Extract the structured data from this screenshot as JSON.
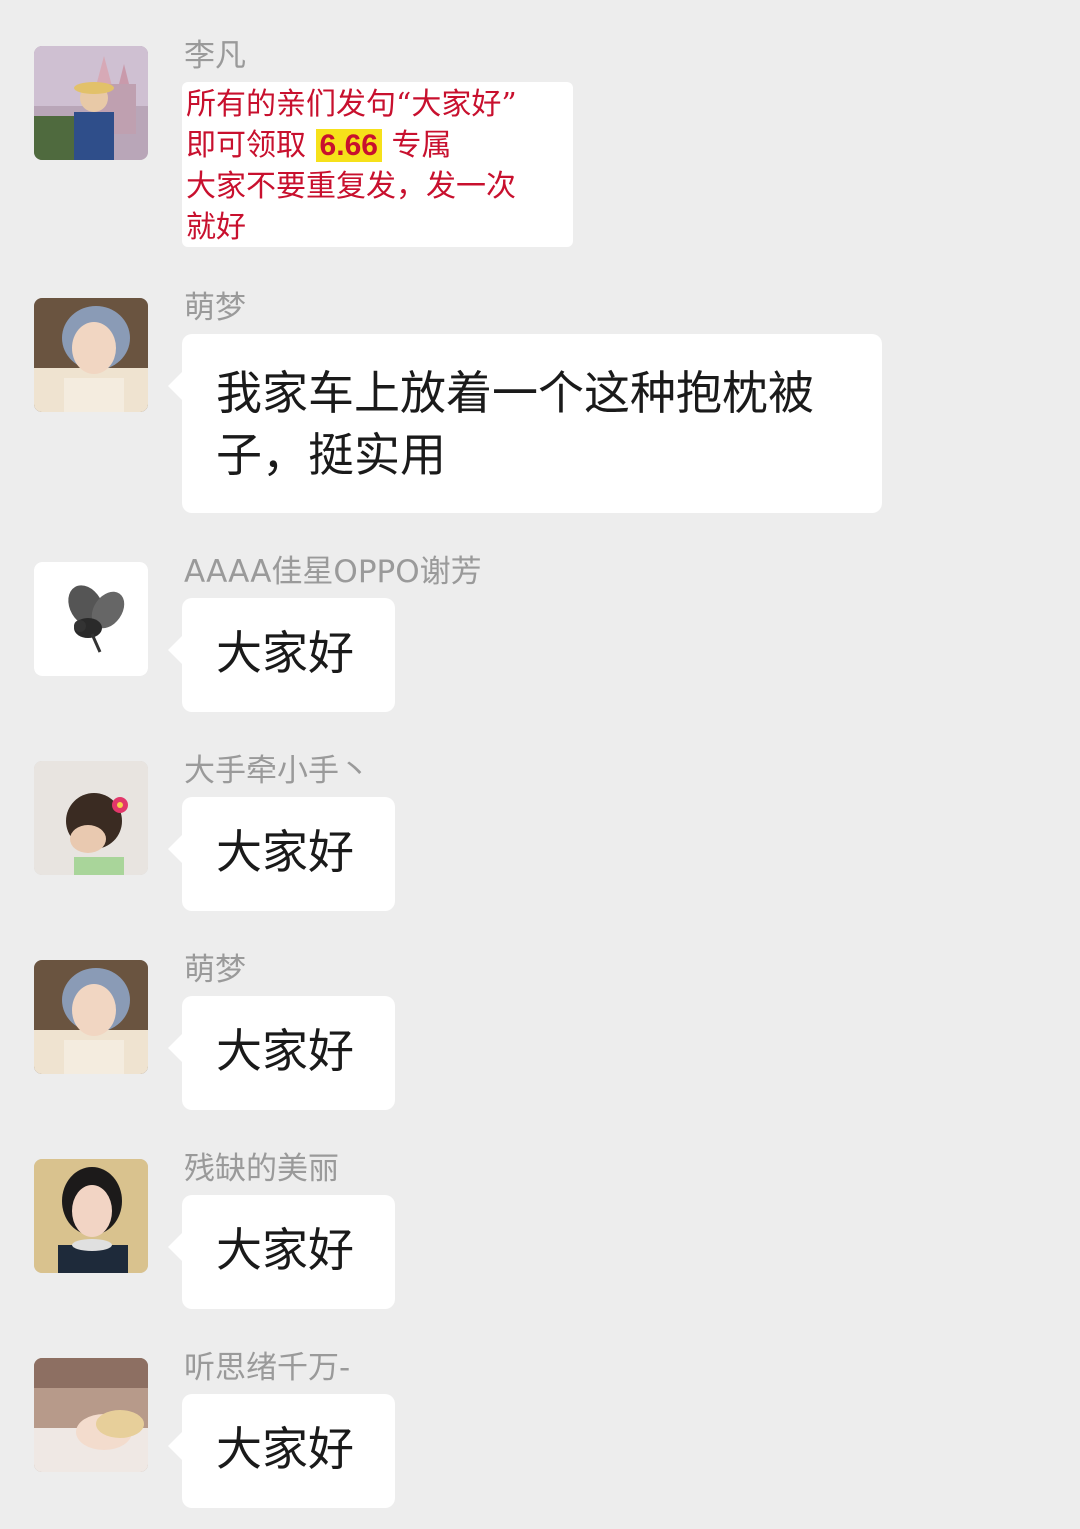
{
  "messages": [
    {
      "sender": "李凡",
      "avatar_icon": "portrait-castle-avatar-icon",
      "poster": {
        "line1": "所有的亲们发句“大家好”",
        "line2_prefix": "即可领取",
        "amount": "6.66",
        "line2_suffix": "专属",
        "line3": "大家不要重复发，发一次",
        "line4": "就好"
      }
    },
    {
      "sender": "萌梦",
      "avatar_icon": "portrait-woman-avatar-icon",
      "text_line1": "我家车上放着一个这种抱枕被",
      "text_line2": "子，挺实用"
    },
    {
      "sender": "AAAA佳星OPPO谢芳",
      "avatar_icon": "bee-avatar-icon",
      "text": "大家好"
    },
    {
      "sender": "大手牵小手丶",
      "avatar_icon": "child-flower-avatar-icon",
      "text": "大家好"
    },
    {
      "sender": "萌梦",
      "avatar_icon": "portrait-woman-avatar-icon",
      "text": "大家好"
    },
    {
      "sender": "残缺的美丽",
      "avatar_icon": "portrait-woman-dark-hair-avatar-icon",
      "text": "大家好"
    },
    {
      "sender": "听思绪千万-",
      "avatar_icon": "portrait-lying-avatar-icon",
      "text": "大家好"
    }
  ],
  "colors": {
    "background": "#ededed",
    "bubble": "#ffffff",
    "sender_name": "#9a9a9a",
    "poster_text": "#c8102e",
    "highlight": "#f6e11a"
  }
}
